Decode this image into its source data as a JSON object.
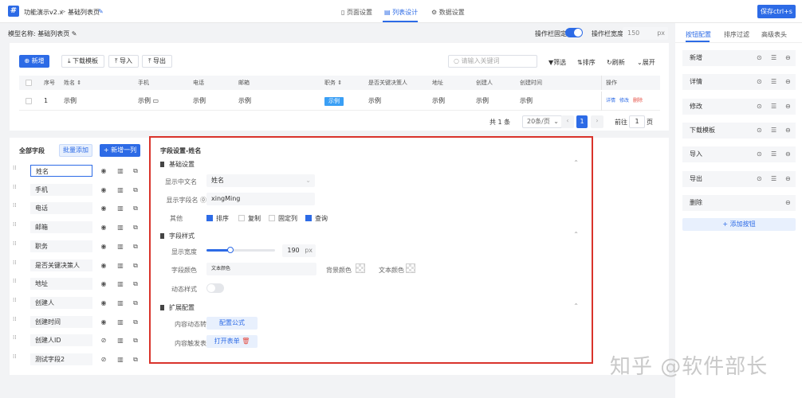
{
  "topbar": {
    "app_title": "功能演示v2.x",
    "sep": ">",
    "page_title": "基础列表页",
    "tabs": [
      "页面设置",
      "列表设计",
      "数据设置"
    ],
    "save_label": "保存ctrl+s"
  },
  "model": {
    "label": "模型名称:",
    "value": "基础列表页",
    "col_fixed_label": "操作栏固定",
    "col_width_label": "操作栏宽度",
    "col_width_value": "150",
    "col_width_unit": "px"
  },
  "toolbar": {
    "add": "新增",
    "download": "下载模板",
    "import": "导入",
    "export": "导出",
    "search_placeholder": "请输入关键词",
    "filter": "筛选",
    "sort": "排序",
    "refresh": "刷新",
    "expand": "展开"
  },
  "table": {
    "headers": [
      "序号",
      "姓名",
      "手机",
      "电话",
      "邮箱",
      "职务",
      "是否关键决策人",
      "地址",
      "创建人",
      "创建时间",
      "操作"
    ],
    "row": [
      "1",
      "示例",
      "示例",
      "示例",
      "示例",
      "示例",
      "示例",
      "示例",
      "示例",
      "示例"
    ],
    "actions": [
      "详情",
      "修改",
      "删除"
    ]
  },
  "pager": {
    "total": "共 1 条",
    "page_size": "20条/页",
    "current": "1",
    "goto_label": "前往",
    "goto_value": "1",
    "page_unit": "页"
  },
  "fields": {
    "title": "全部字段",
    "batch_add": "批量添加",
    "add_column": "新增一列",
    "items": [
      "姓名",
      "手机",
      "电话",
      "邮箱",
      "职务",
      "是否关键决策人",
      "地址",
      "创建人",
      "创建时间",
      "创建人ID",
      "测试字段2"
    ]
  },
  "settings": {
    "title": "字段设置-姓名",
    "basic": {
      "title": "基础设置",
      "cn_name_label": "显示中文名",
      "cn_name_value": "姓名",
      "field_name_label": "显示字段名",
      "field_name_value": "xingMing",
      "other_label": "其他",
      "options": [
        {
          "label": "排序",
          "checked": true
        },
        {
          "label": "复制",
          "checked": false
        },
        {
          "label": "固定列",
          "checked": false
        },
        {
          "label": "查询",
          "checked": true
        }
      ]
    },
    "style": {
      "title": "字段样式",
      "width_label": "显示宽度",
      "width_value": "190",
      "width_unit": "px",
      "color_label": "字段颜色",
      "text_color_placeholder": "文本颜色",
      "bg_color_label": "背景颜色",
      "text_color_label": "文本颜色",
      "dynamic_label": "动态样式"
    },
    "extend": {
      "title": "扩展配置",
      "dynamic_convert_label": "内容动态转换",
      "formula_btn": "配置公式",
      "trigger_label": "内容触发表单",
      "open_form_btn": "打开表单"
    }
  },
  "right": {
    "tabs": [
      "按钮配置",
      "排序过滤",
      "高级表头"
    ],
    "buttons": [
      "新增",
      "详情",
      "修改",
      "下载模板",
      "导入",
      "导出",
      "删除"
    ],
    "add_button": "+ 添加按钮"
  },
  "watermark": "知乎 @软件部长",
  "colors": {
    "accent": "#2d6be6",
    "highlight": "#d9332b",
    "tag": "#3a9ff5"
  }
}
